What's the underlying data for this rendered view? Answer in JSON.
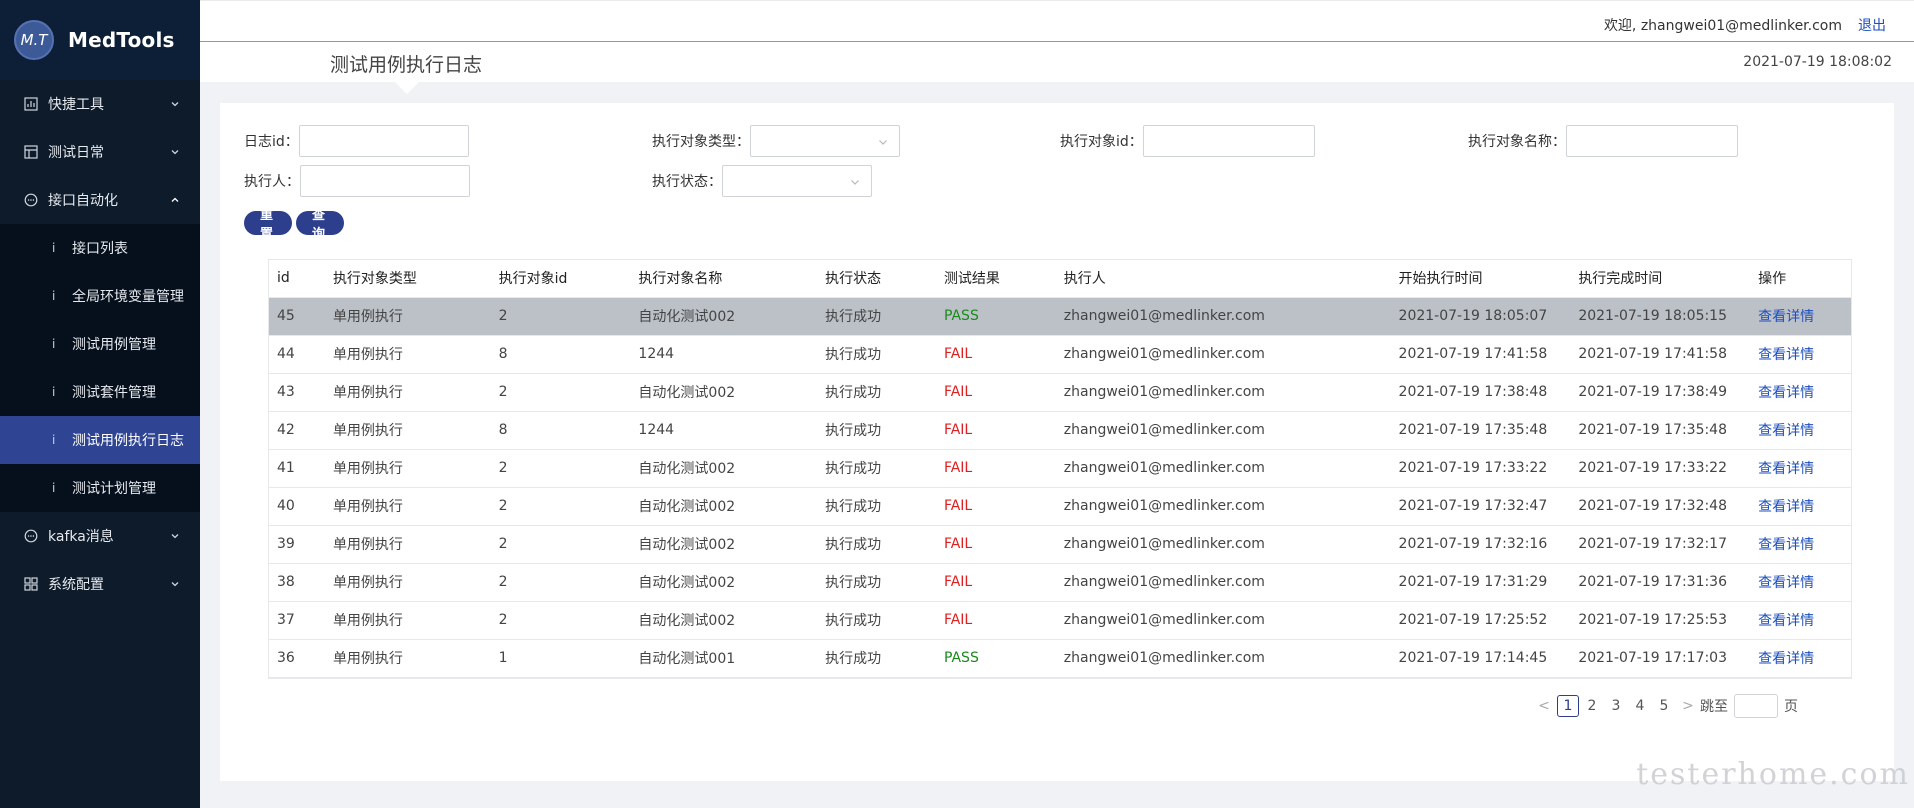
{
  "brand": {
    "logo_mark": "M.T",
    "name": "MedTools"
  },
  "sidebar": {
    "groups": [
      {
        "label": "快捷工具",
        "icon": "chart-icon",
        "expanded": false
      },
      {
        "label": "测试日常",
        "icon": "calendar-icon",
        "expanded": false
      },
      {
        "label": "接口自动化",
        "icon": "chat-icon",
        "expanded": true,
        "items": [
          {
            "label": "接口列表",
            "active": false
          },
          {
            "label": "全局环境变量管理",
            "active": false
          },
          {
            "label": "测试用例管理",
            "active": false
          },
          {
            "label": "测试套件管理",
            "active": false
          },
          {
            "label": "测试用例执行日志",
            "active": true
          },
          {
            "label": "测试计划管理",
            "active": false
          }
        ]
      },
      {
        "label": "kafka消息",
        "icon": "chat-icon",
        "expanded": false
      },
      {
        "label": "系统配置",
        "icon": "grid-icon",
        "expanded": false
      }
    ],
    "item_marker": "i"
  },
  "header": {
    "welcome": "欢迎, zhangwei01@medlinker.com",
    "logout": "退出"
  },
  "titlebar": {
    "title": "测试用例执行日志",
    "datetime": "2021-07-19 18:08:02"
  },
  "filters": {
    "log_id_label": "日志id：",
    "target_type_label": "执行对象类型：",
    "target_id_label": "执行对象id：",
    "target_name_label": "执行对象名称：",
    "executor_label": "执行人：",
    "status_label": "执行状态：",
    "reset_button": "重 置",
    "query_button": "查 询"
  },
  "table": {
    "columns": [
      "id",
      "执行对象类型",
      "执行对象id",
      "执行对象名称",
      "执行状态",
      "测试结果",
      "执行人",
      "开始执行时间",
      "执行完成时间",
      "操作"
    ],
    "rows": [
      [
        "45",
        "单用例执行",
        "2",
        "自动化测试002",
        "执行成功",
        "PASS",
        "zhangwei01@medlinker.com",
        "2021-07-19 18:05:07",
        "2021-07-19 18:05:15",
        "查看详情"
      ],
      [
        "44",
        "单用例执行",
        "8",
        "1244",
        "执行成功",
        "FAIL",
        "zhangwei01@medlinker.com",
        "2021-07-19 17:41:58",
        "2021-07-19 17:41:58",
        "查看详情"
      ],
      [
        "43",
        "单用例执行",
        "2",
        "自动化测试002",
        "执行成功",
        "FAIL",
        "zhangwei01@medlinker.com",
        "2021-07-19 17:38:48",
        "2021-07-19 17:38:49",
        "查看详情"
      ],
      [
        "42",
        "单用例执行",
        "8",
        "1244",
        "执行成功",
        "FAIL",
        "zhangwei01@medlinker.com",
        "2021-07-19 17:35:48",
        "2021-07-19 17:35:48",
        "查看详情"
      ],
      [
        "41",
        "单用例执行",
        "2",
        "自动化测试002",
        "执行成功",
        "FAIL",
        "zhangwei01@medlinker.com",
        "2021-07-19 17:33:22",
        "2021-07-19 17:33:22",
        "查看详情"
      ],
      [
        "40",
        "单用例执行",
        "2",
        "自动化测试002",
        "执行成功",
        "FAIL",
        "zhangwei01@medlinker.com",
        "2021-07-19 17:32:47",
        "2021-07-19 17:32:48",
        "查看详情"
      ],
      [
        "39",
        "单用例执行",
        "2",
        "自动化测试002",
        "执行成功",
        "FAIL",
        "zhangwei01@medlinker.com",
        "2021-07-19 17:32:16",
        "2021-07-19 17:32:17",
        "查看详情"
      ],
      [
        "38",
        "单用例执行",
        "2",
        "自动化测试002",
        "执行成功",
        "FAIL",
        "zhangwei01@medlinker.com",
        "2021-07-19 17:31:29",
        "2021-07-19 17:31:36",
        "查看详情"
      ],
      [
        "37",
        "单用例执行",
        "2",
        "自动化测试002",
        "执行成功",
        "FAIL",
        "zhangwei01@medlinker.com",
        "2021-07-19 17:25:52",
        "2021-07-19 17:25:53",
        "查看详情"
      ],
      [
        "36",
        "单用例执行",
        "1",
        "自动化测试001",
        "执行成功",
        "PASS",
        "zhangwei01@medlinker.com",
        "2021-07-19 17:14:45",
        "2021-07-19 17:17:03",
        "查看详情"
      ]
    ],
    "selected_row": 0
  },
  "pagination": {
    "prev": "<",
    "next": ">",
    "pages": [
      "1",
      "2",
      "3",
      "4",
      "5"
    ],
    "current": "1",
    "jump_label": "跳至",
    "page_suffix": "页"
  },
  "watermark": "testerhome.com",
  "colors": {
    "sidebar_bg": "#0d1b2a",
    "active_item": "#2f4593",
    "button": "#2c3e8c",
    "pass": "#1a8a1a",
    "fail": "#e02020",
    "link": "#1e4fbf"
  }
}
